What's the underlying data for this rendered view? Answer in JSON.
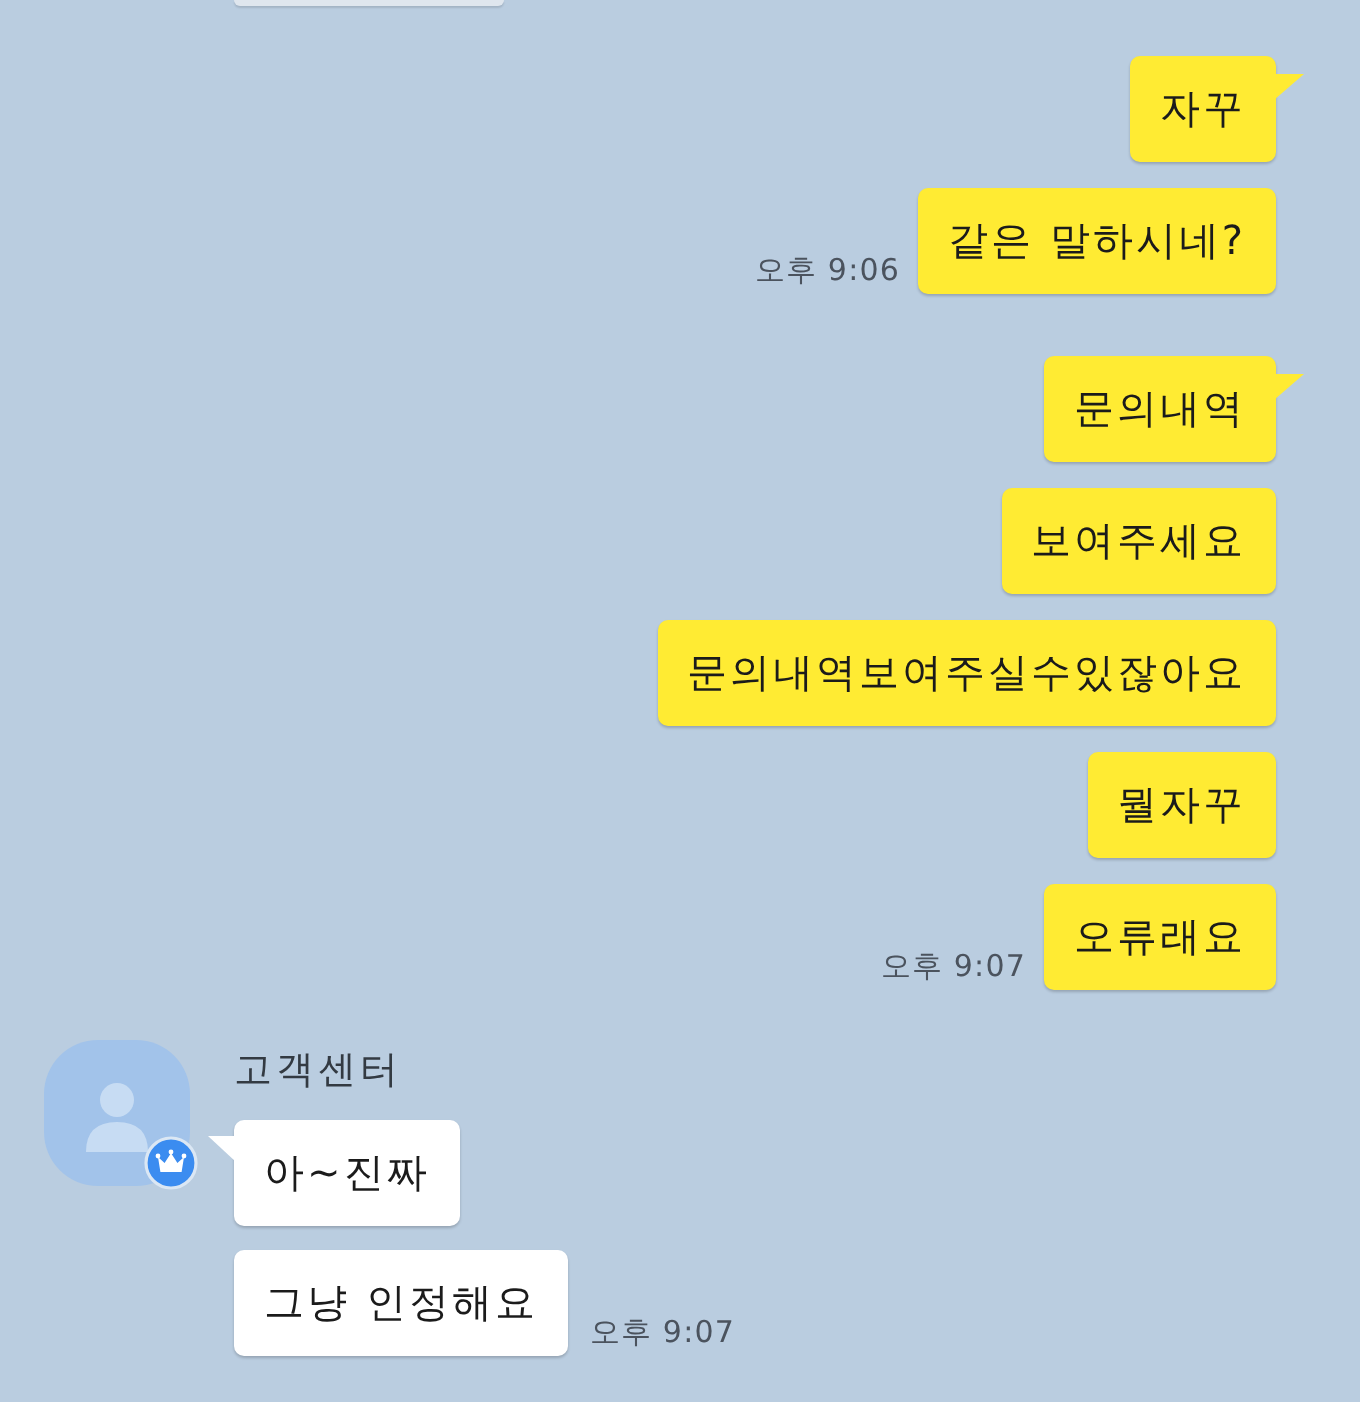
{
  "conversation": [
    {
      "kind": "cut_off"
    },
    {
      "kind": "outgoing",
      "messages": [
        "자꾸",
        "같은 말하시네?"
      ],
      "time": "오후 9:06"
    },
    {
      "kind": "outgoing",
      "messages": [
        "문의내역",
        "보여주세요",
        "문의내역보여주실수있잖아요",
        "뭘자꾸",
        "오류래요"
      ],
      "time": "오후 9:07"
    },
    {
      "kind": "incoming",
      "name": "고객센터",
      "official_badge": true,
      "messages": [
        "아~진짜",
        "그냥 인정해요"
      ],
      "time": "오후 9:07"
    }
  ]
}
